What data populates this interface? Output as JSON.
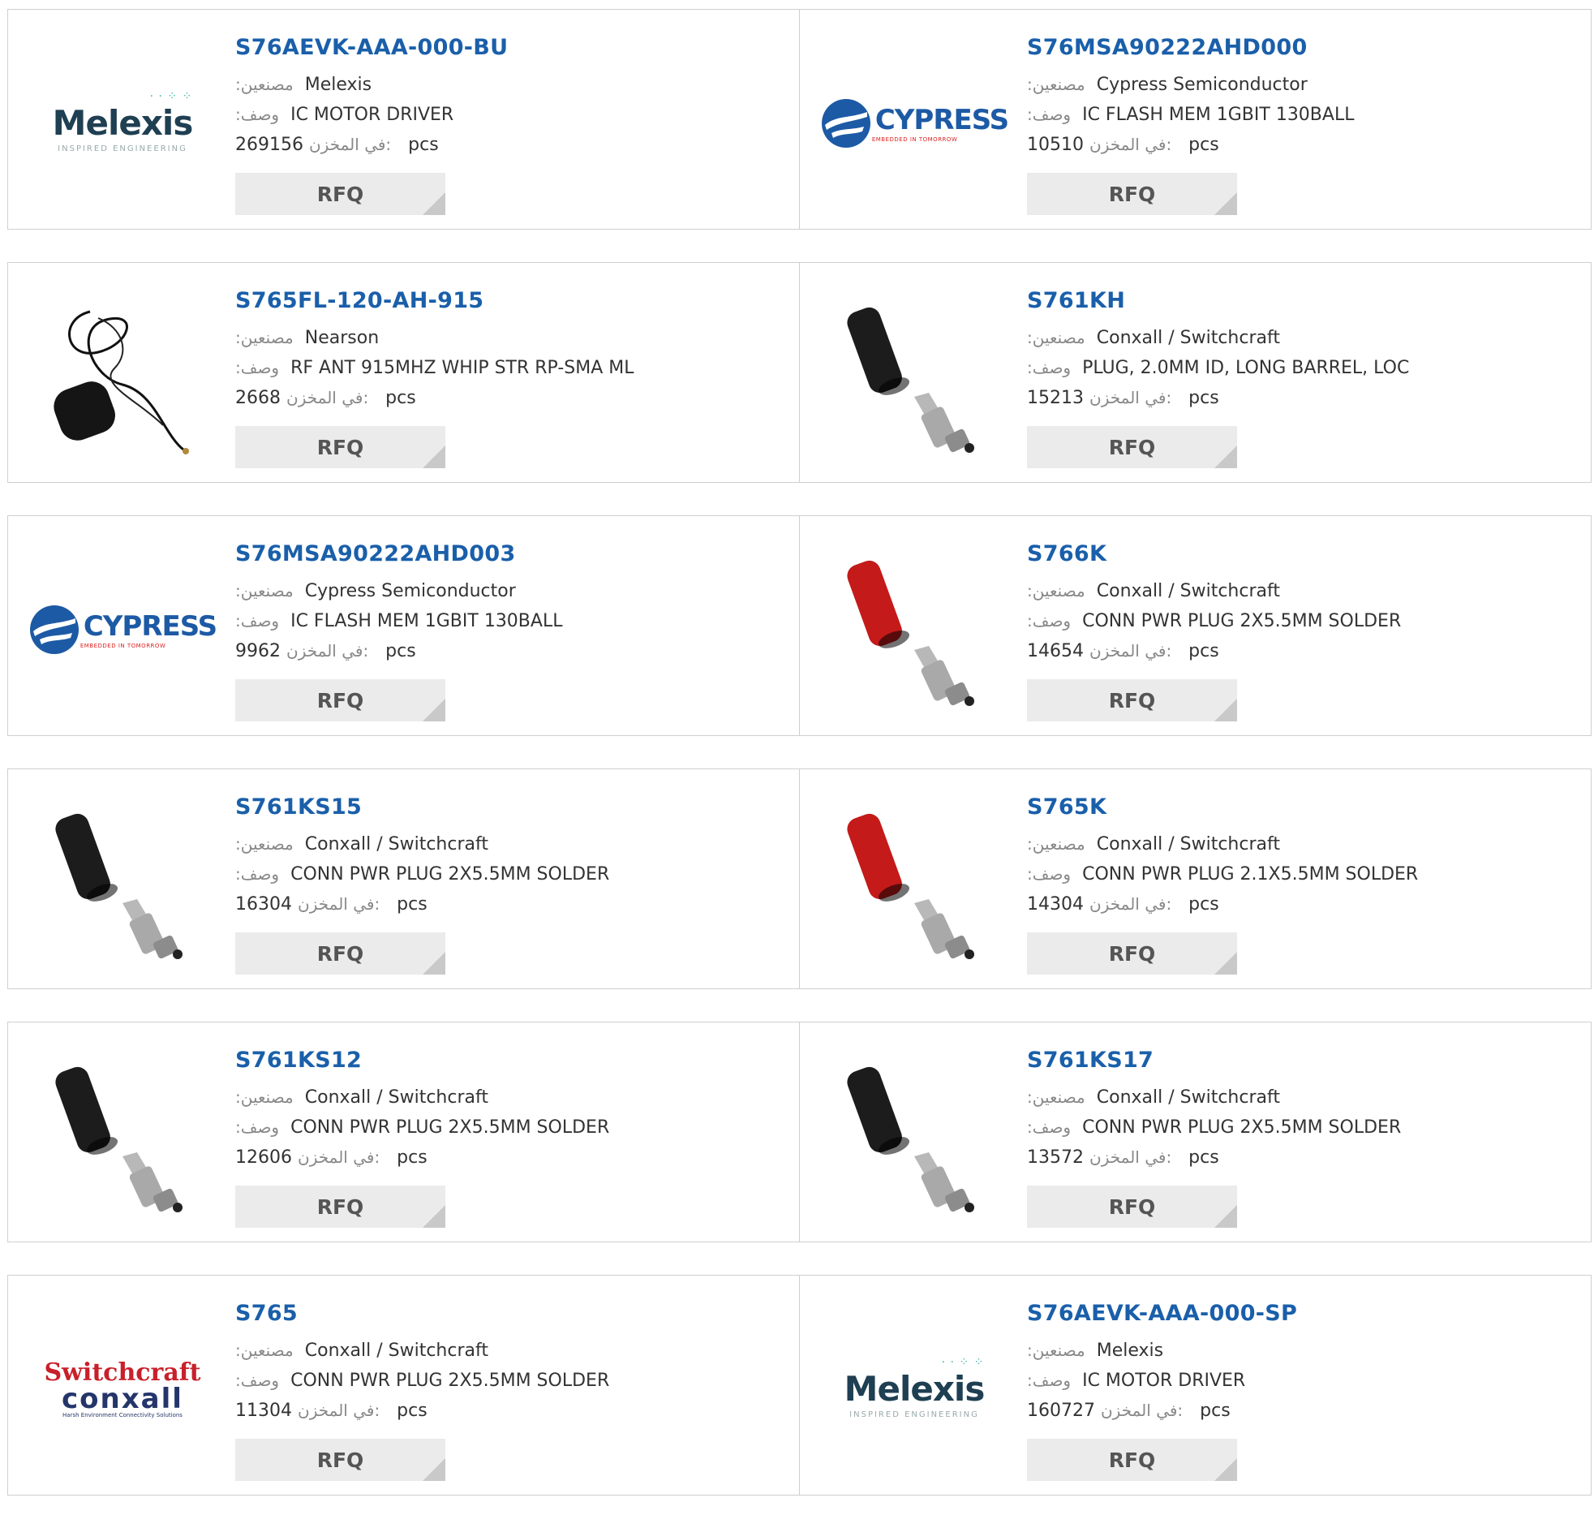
{
  "labels": {
    "manufacturer": ":مصنعين",
    "description": ":وصف",
    "stock": "في المخزن:",
    "unit": "pcs",
    "rfq": "RFQ"
  },
  "products": [
    {
      "part": "S76AEVK-AAA-000-BU",
      "manufacturer": "Melexis",
      "description": "IC MOTOR DRIVER",
      "stock": "269156",
      "image": "melexis-logo"
    },
    {
      "part": "S76MSA90222AHD000",
      "manufacturer": "Cypress Semiconductor",
      "description": "IC FLASH MEM 1GBIT 130BALL",
      "stock": "10510",
      "image": "cypress-logo"
    },
    {
      "part": "S765FL-120-AH-915",
      "manufacturer": "Nearson",
      "description": "RF ANT 915MHZ WHIP STR RP-SMA ML",
      "stock": "2668",
      "image": "antenna-photo"
    },
    {
      "part": "S761KH",
      "manufacturer": "Conxall / Switchcraft",
      "description": "PLUG, 2.0MM ID, LONG BARREL, LOC",
      "stock": "15213",
      "image": "black-plug-photo"
    },
    {
      "part": "S76MSA90222AHD003",
      "manufacturer": "Cypress Semiconductor",
      "description": "IC FLASH MEM 1GBIT 130BALL",
      "stock": "9962",
      "image": "cypress-logo"
    },
    {
      "part": "S766K",
      "manufacturer": "Conxall / Switchcraft",
      "description": "CONN PWR PLUG 2X5.5MM SOLDER",
      "stock": "14654",
      "image": "red-plug-photo"
    },
    {
      "part": "S761KS15",
      "manufacturer": "Conxall / Switchcraft",
      "description": "CONN PWR PLUG 2X5.5MM SOLDER",
      "stock": "16304",
      "image": "black-plug-photo"
    },
    {
      "part": "S765K",
      "manufacturer": "Conxall / Switchcraft",
      "description": "CONN PWR PLUG 2.1X5.5MM SOLDER",
      "stock": "14304",
      "image": "red-plug-photo"
    },
    {
      "part": "S761KS12",
      "manufacturer": "Conxall / Switchcraft",
      "description": "CONN PWR PLUG 2X5.5MM SOLDER",
      "stock": "12606",
      "image": "black-plug-photo"
    },
    {
      "part": "S761KS17",
      "manufacturer": "Conxall / Switchcraft",
      "description": "CONN PWR PLUG 2X5.5MM SOLDER",
      "stock": "13572",
      "image": "black-plug-photo"
    },
    {
      "part": "S765",
      "manufacturer": "Conxall / Switchcraft",
      "description": "CONN PWR PLUG 2X5.5MM SOLDER",
      "stock": "11304",
      "image": "switchcraft-logo"
    },
    {
      "part": "S76AEVK-AAA-000-SP",
      "manufacturer": "Melexis",
      "description": "IC MOTOR DRIVER",
      "stock": "160727",
      "image": "melexis-logo"
    }
  ],
  "logos": {
    "melexis": {
      "word": "Melexis",
      "tagline": "INSPIRED ENGINEERING"
    },
    "cypress": {
      "word": "CYPRESS",
      "tagline": "EMBEDDED IN TOMORROW"
    },
    "switchcraft": {
      "line1": "Switchcraft",
      "line2": "conxall",
      "tagline": "Harsh Environment Connectivity Solutions"
    }
  },
  "colors": {
    "link": "#1a5faa",
    "button_bg": "#ebebeb",
    "border": "#cfcfcf"
  }
}
